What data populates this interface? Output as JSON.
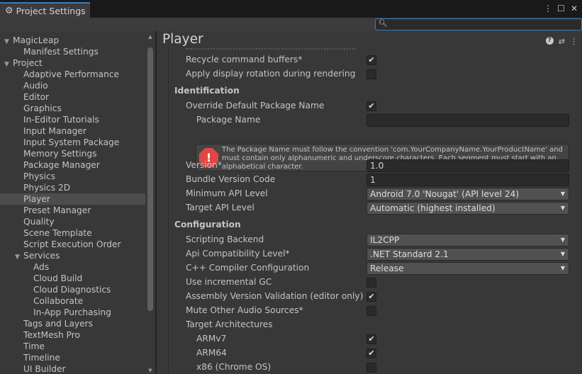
{
  "window": {
    "tab_title": "Project Settings",
    "search_placeholder": ""
  },
  "sidebar": {
    "items": [
      {
        "label": "MagicLeap",
        "level": 0,
        "expanded": true
      },
      {
        "label": "Manifest Settings",
        "level": 1
      },
      {
        "label": "Project",
        "level": 0,
        "expanded": true
      },
      {
        "label": "Adaptive Performance",
        "level": 1
      },
      {
        "label": "Audio",
        "level": 1
      },
      {
        "label": "Editor",
        "level": 1
      },
      {
        "label": "Graphics",
        "level": 1
      },
      {
        "label": "In-Editor Tutorials",
        "level": 1
      },
      {
        "label": "Input Manager",
        "level": 1
      },
      {
        "label": "Input System Package",
        "level": 1
      },
      {
        "label": "Memory Settings",
        "level": 1
      },
      {
        "label": "Package Manager",
        "level": 1
      },
      {
        "label": "Physics",
        "level": 1
      },
      {
        "label": "Physics 2D",
        "level": 1
      },
      {
        "label": "Player",
        "level": 1,
        "selected": true
      },
      {
        "label": "Preset Manager",
        "level": 1
      },
      {
        "label": "Quality",
        "level": 1
      },
      {
        "label": "Scene Template",
        "level": 1
      },
      {
        "label": "Script Execution Order",
        "level": 1
      },
      {
        "label": "Services",
        "level": 1,
        "expanded": true
      },
      {
        "label": "Ads",
        "level": 2
      },
      {
        "label": "Cloud Build",
        "level": 2
      },
      {
        "label": "Cloud Diagnostics",
        "level": 2
      },
      {
        "label": "Collaborate",
        "level": 2
      },
      {
        "label": "In-App Purchasing",
        "level": 2
      },
      {
        "label": "Tags and Layers",
        "level": 1
      },
      {
        "label": "TextMesh Pro",
        "level": 1
      },
      {
        "label": "Time",
        "level": 1
      },
      {
        "label": "Timeline",
        "level": 1
      },
      {
        "label": "UI Builder",
        "level": 1
      }
    ]
  },
  "main": {
    "title": "Player",
    "rows": [
      {
        "label": "Recycle command buffers*",
        "indent": 1,
        "type": "checkbox",
        "checked": true
      },
      {
        "label": "Apply display rotation during rendering",
        "indent": 1,
        "type": "checkbox",
        "checked": false
      },
      {
        "label": "Identification",
        "type": "section"
      },
      {
        "label": "Override Default Package Name",
        "indent": 1,
        "type": "checkbox",
        "checked": true
      },
      {
        "label": "Package Name",
        "indent": 2,
        "type": "text",
        "value": ""
      },
      {
        "type": "helpbox",
        "message": "The Package Name must follow the convention 'com.YourCompanyName.YourProductName' and must contain only alphanumeric and underscore characters. Each segment must start with an alphabetical character."
      },
      {
        "label": "Version*",
        "indent": 1,
        "type": "text",
        "value": "1.0"
      },
      {
        "label": "Bundle Version Code",
        "indent": 1,
        "type": "text",
        "value": "1"
      },
      {
        "label": "Minimum API Level",
        "indent": 1,
        "type": "dropdown",
        "value": "Android 7.0 'Nougat' (API level 24)"
      },
      {
        "label": "Target API Level",
        "indent": 1,
        "type": "dropdown",
        "value": "Automatic (highest installed)"
      },
      {
        "label": "Configuration",
        "type": "section"
      },
      {
        "label": "Scripting Backend",
        "indent": 1,
        "type": "dropdown",
        "value": "IL2CPP"
      },
      {
        "label": "Api Compatibility Level*",
        "indent": 1,
        "type": "dropdown",
        "value": ".NET Standard 2.1"
      },
      {
        "label": "C++ Compiler Configuration",
        "indent": 1,
        "type": "dropdown",
        "value": "Release"
      },
      {
        "label": "Use incremental GC",
        "indent": 1,
        "type": "checkbox",
        "checked": false
      },
      {
        "label": "Assembly Version Validation (editor only)",
        "indent": 1,
        "type": "checkbox",
        "checked": true
      },
      {
        "label": "Mute Other Audio Sources*",
        "indent": 1,
        "type": "checkbox",
        "checked": false
      },
      {
        "label": "Target Architectures",
        "indent": 1,
        "type": "heading"
      },
      {
        "label": "ARMv7",
        "indent": 2,
        "type": "checkbox",
        "checked": true
      },
      {
        "label": "ARM64",
        "indent": 2,
        "type": "checkbox",
        "checked": true
      },
      {
        "label": "x86 (Chrome OS)",
        "indent": 2,
        "type": "checkbox",
        "checked": false
      }
    ]
  },
  "icons": {
    "tab": "gear-icon",
    "error": "error-icon",
    "check": "checkmark-icon"
  },
  "colors": {
    "accent": "#3a79bb",
    "error": "#e04646",
    "selection": "#4d4d4d"
  }
}
